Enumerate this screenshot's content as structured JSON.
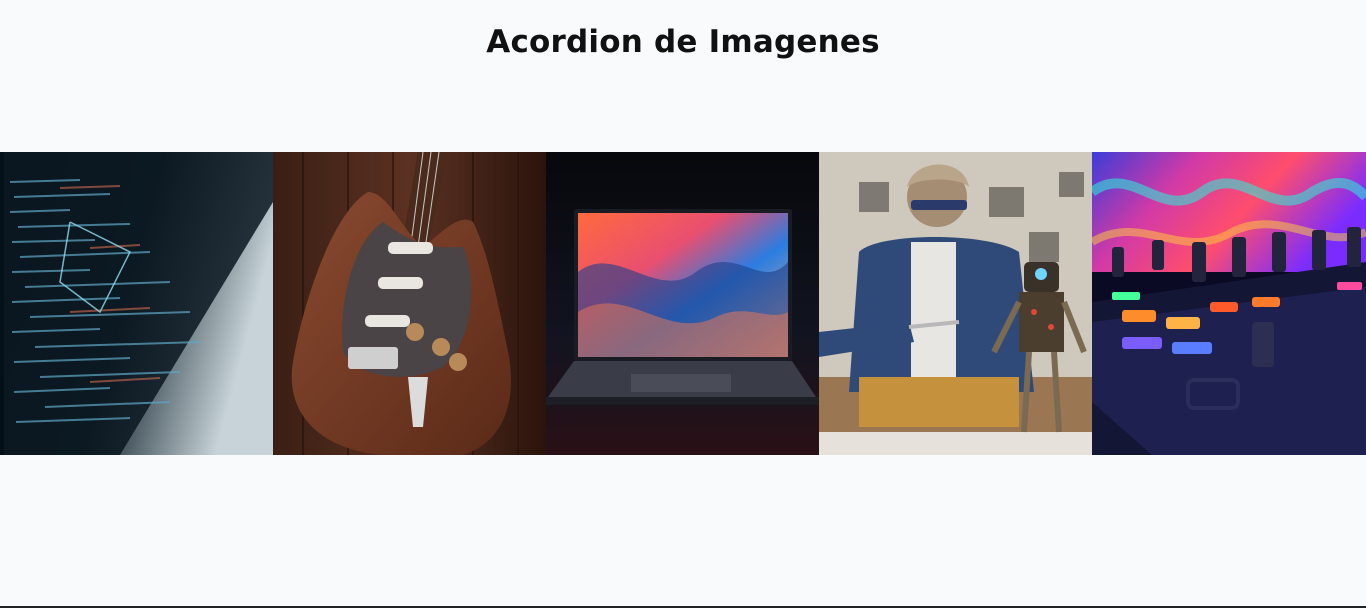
{
  "page": {
    "title": "Acordion de Imagenes"
  },
  "accordion": {
    "panels": [
      {
        "icon": "code-screen-image"
      },
      {
        "icon": "electric-guitar-image"
      },
      {
        "icon": "laptop-image"
      },
      {
        "icon": "robot-builder-image"
      },
      {
        "icon": "dj-mixer-image"
      }
    ]
  },
  "colors": {
    "background": "#f8fafc",
    "title": "#111111"
  }
}
